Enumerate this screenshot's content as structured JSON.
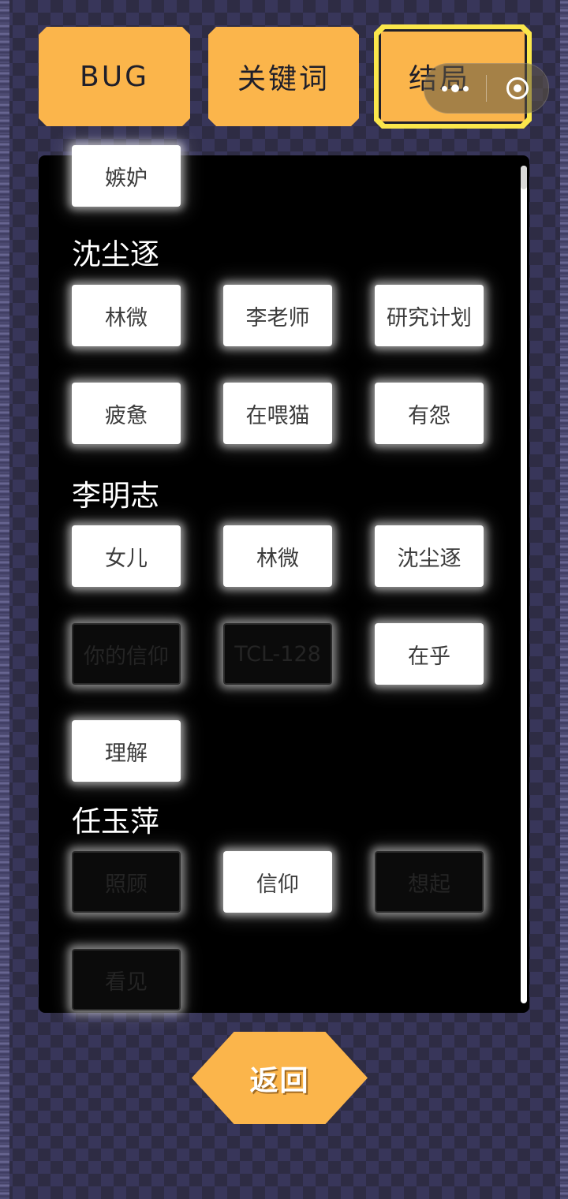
{
  "tabs": [
    {
      "label": "BUG"
    },
    {
      "label": "关键词"
    },
    {
      "label": "结局"
    }
  ],
  "sections": [
    {
      "title": "",
      "chips": [
        {
          "label": "嫉妒",
          "state": "on"
        }
      ]
    },
    {
      "title": "沈尘逐",
      "chips": [
        {
          "label": "林微",
          "state": "on"
        },
        {
          "label": "李老师",
          "state": "on"
        },
        {
          "label": "研究计划",
          "state": "on"
        },
        {
          "label": "疲惫",
          "state": "on"
        },
        {
          "label": "在喂猫",
          "state": "on"
        },
        {
          "label": "有怨",
          "state": "on"
        }
      ]
    },
    {
      "title": "李明志",
      "chips": [
        {
          "label": "女儿",
          "state": "on"
        },
        {
          "label": "林微",
          "state": "on"
        },
        {
          "label": "沈尘逐",
          "state": "on"
        },
        {
          "label": "你的信仰",
          "state": "off"
        },
        {
          "label": "TCL-128",
          "state": "off"
        },
        {
          "label": "在乎",
          "state": "on"
        },
        {
          "label": "理解",
          "state": "on"
        }
      ]
    },
    {
      "title": "任玉萍",
      "chips": [
        {
          "label": "照顾",
          "state": "off"
        },
        {
          "label": "信仰",
          "state": "on"
        },
        {
          "label": "想起",
          "state": "off"
        },
        {
          "label": "看见",
          "state": "off"
        }
      ]
    }
  ],
  "back_label": "返回",
  "colors": {
    "accent": "#fbb54b",
    "active_border": "#fbe74b",
    "panel": "#000000",
    "background": "#2e2c44"
  },
  "icons": {
    "capsule_menu": "more-dots-icon",
    "capsule_close": "target-circle-icon"
  }
}
